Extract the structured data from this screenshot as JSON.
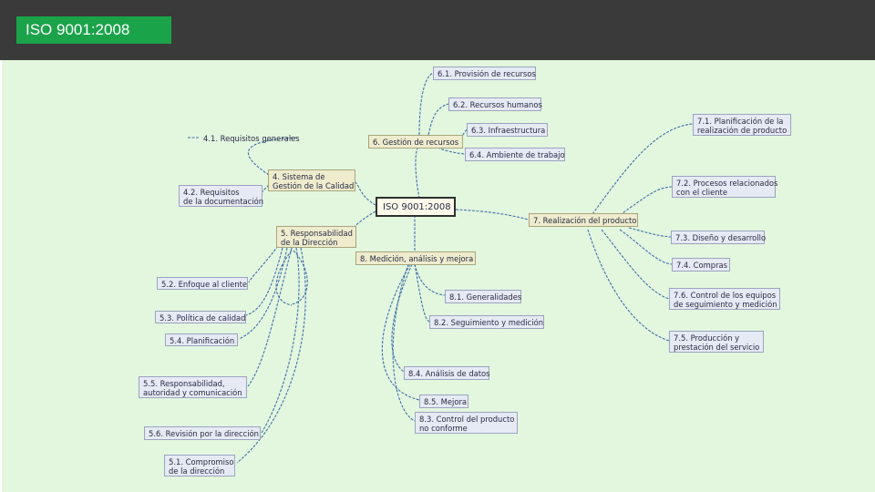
{
  "header": {
    "title": "ISO 9001:2008"
  },
  "colors": {
    "header_bg": "#3a3a3a",
    "title_tab": "#1ba34a",
    "canvas_bg": "#e3f7df",
    "link": "#3f6fa8"
  },
  "mindmap": {
    "root": "ISO 9001:2008",
    "n4": {
      "line1": "4. Sistema de",
      "line2": "Gestión de la Calidad"
    },
    "n4_1": "4.1. Requisitos generales",
    "n4_2": {
      "line1": "4.2. Requisitos",
      "line2": "de la documentación"
    },
    "n5": {
      "line1": "5. Responsabilidad",
      "line2": "de la Dirección"
    },
    "n5_2": "5.2. Enfoque al cliente",
    "n5_3": "5.3. Política de calidad",
    "n5_4": "5.4. Planificación",
    "n5_5": {
      "line1": "5.5. Responsabilidad,",
      "line2": "autoridad y comunicación"
    },
    "n5_6": "5.6. Revisión por la dirección",
    "n5_1": {
      "line1": "5.1. Compromiso",
      "line2": "de la dirección"
    },
    "n6": "6. Gestión de recursos",
    "n6_1": "6.1. Provisión de recursos",
    "n6_2": "6.2. Recursos humanos",
    "n6_3": "6.3. Infraestructura",
    "n6_4": "6.4. Ambiente de trabajo",
    "n7": "7. Realización del producto",
    "n7_1": {
      "line1": "7.1. Planificación de la",
      "line2": "realización de producto"
    },
    "n7_2": {
      "line1": "7.2. Procesos relacionados",
      "line2": "con el cliente"
    },
    "n7_3": "7.3. Diseño y desarrollo",
    "n7_4": "7.4. Compras",
    "n7_6": {
      "line1": "7.6. Control de los equipos",
      "line2": "de seguimiento y medición"
    },
    "n7_5": {
      "line1": "7.5. Producción y",
      "line2": "prestación del servicio"
    },
    "n8": "8. Medición, análisis y mejora",
    "n8_1": "8.1. Generalidades",
    "n8_2": "8.2. Seguimiento y medición",
    "n8_4": "8.4. Análisis de datos",
    "n8_5": "8.5. Mejora",
    "n8_3": {
      "line1": "8.3. Control del producto",
      "line2": "no conforme"
    }
  }
}
